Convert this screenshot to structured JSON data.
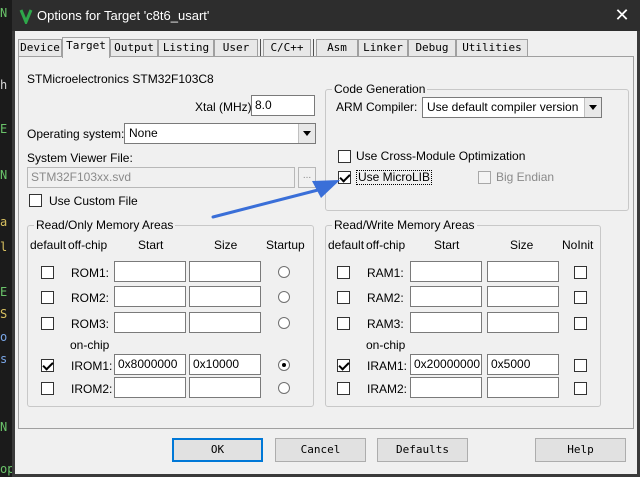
{
  "window": {
    "title": "Options for Target 'c8t6_usart'",
    "close_glyph": "✕"
  },
  "tabs": [
    {
      "label": "Device"
    },
    {
      "label": "Target"
    },
    {
      "label": "Output"
    },
    {
      "label": "Listing"
    },
    {
      "label": "User"
    },
    {
      "label": "C/C++"
    },
    {
      "label": "Asm"
    },
    {
      "label": "Linker"
    },
    {
      "label": "Debug"
    },
    {
      "label": "Utilities"
    }
  ],
  "active_tab": "Target",
  "device": {
    "name": "STMicroelectronics STM32F103C8"
  },
  "xtal": {
    "label": "Xtal (MHz):",
    "value": "8.0"
  },
  "os": {
    "label": "Operating system:",
    "value": "None"
  },
  "svd": {
    "label": "System Viewer File:",
    "value": "STM32F103xx.svd",
    "browse_label": "..."
  },
  "custom_file": {
    "label": "Use Custom File",
    "checked": false
  },
  "codegen": {
    "title": "Code Generation",
    "compiler_label": "ARM Compiler:",
    "compiler_value": "Use default compiler version",
    "cross_module": {
      "label": "Use Cross-Module Optimization",
      "checked": false
    },
    "microlib": {
      "label": "Use MicroLIB",
      "checked": true
    },
    "big_endian": {
      "label": "Big Endian",
      "checked": false,
      "disabled": true
    }
  },
  "ro_memory": {
    "title": "Read/Only Memory Areas",
    "headers": {
      "default": "default",
      "offchip": "off-chip",
      "start": "Start",
      "size": "Size",
      "startup": "Startup"
    },
    "onchip_label": "on-chip",
    "rows": [
      {
        "name": "ROM1:",
        "default": false,
        "start": "",
        "size": "",
        "startup": false
      },
      {
        "name": "ROM2:",
        "default": false,
        "start": "",
        "size": "",
        "startup": false
      },
      {
        "name": "ROM3:",
        "default": false,
        "start": "",
        "size": "",
        "startup": false
      },
      {
        "name": "IROM1:",
        "default": true,
        "start": "0x8000000",
        "size": "0x10000",
        "startup": true
      },
      {
        "name": "IROM2:",
        "default": false,
        "start": "",
        "size": "",
        "startup": false
      }
    ]
  },
  "rw_memory": {
    "title": "Read/Write Memory Areas",
    "headers": {
      "default": "default",
      "offchip": "off-chip",
      "start": "Start",
      "size": "Size",
      "noinit": "NoInit"
    },
    "onchip_label": "on-chip",
    "rows": [
      {
        "name": "RAM1:",
        "default": false,
        "start": "",
        "size": "",
        "noinit": false
      },
      {
        "name": "RAM2:",
        "default": false,
        "start": "",
        "size": "",
        "noinit": false
      },
      {
        "name": "RAM3:",
        "default": false,
        "start": "",
        "size": "",
        "noinit": false
      },
      {
        "name": "IRAM1:",
        "default": true,
        "start": "0x20000000",
        "size": "0x5000",
        "noinit": false
      },
      {
        "name": "IRAM2:",
        "default": false,
        "start": "",
        "size": "",
        "noinit": false
      }
    ]
  },
  "buttons": {
    "ok": "OK",
    "cancel": "Cancel",
    "defaults": "Defaults",
    "help": "Help"
  },
  "annotation": {
    "color": "#3a6fd8"
  },
  "background_editor": {
    "fragments": [
      "N",
      "h",
      "E",
      "N",
      "a",
      "l",
      "E",
      "S",
      "o",
      "s",
      "N",
      "op.*/"
    ]
  }
}
